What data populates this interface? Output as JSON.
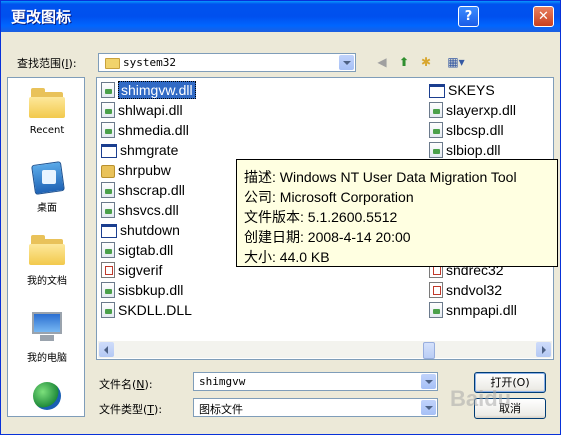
{
  "window": {
    "title": "更改图标",
    "help_label": "?",
    "close_label": "✕"
  },
  "lookin": {
    "label": "查找范围",
    "hotkey": "I",
    "label_suffix": "):",
    "value": "system32"
  },
  "toolbar": {
    "back_icon": "back-arrow-icon",
    "up_icon": "up-folder-icon",
    "new_folder_icon": "new-folder-icon",
    "views_icon": "views-menu-icon"
  },
  "places": [
    {
      "label": "Recent",
      "icon": "recent-folder-icon"
    },
    {
      "label": "桌面",
      "icon": "desktop-icon"
    },
    {
      "label": "我的文档",
      "icon": "my-documents-icon"
    },
    {
      "label": "我的电脑",
      "icon": "my-computer-icon"
    },
    {
      "label": "",
      "icon": "network-icon"
    }
  ],
  "files_col1": [
    {
      "name": "shimgvw.dll",
      "type": "dll",
      "selected": true
    },
    {
      "name": "shlwapi.dll",
      "type": "dll"
    },
    {
      "name": "shmedia.dll",
      "type": "dll"
    },
    {
      "name": "shmgrate",
      "type": "exe"
    },
    {
      "name": "shrpubw",
      "type": "folder"
    },
    {
      "name": "shscrap.dll",
      "type": "dll"
    },
    {
      "name": "shsvcs.dll",
      "type": "dll"
    },
    {
      "name": "shutdown",
      "type": "exe"
    },
    {
      "name": "sigtab.dll",
      "type": "dll"
    },
    {
      "name": "sigverif",
      "type": "generic"
    },
    {
      "name": "sisbkup.dll",
      "type": "dll"
    },
    {
      "name": "SKDLL.DLL",
      "type": "dll"
    }
  ],
  "files_col2": [
    {
      "name": "SKEYS",
      "type": "exe"
    },
    {
      "name": "slayerxp.dll",
      "type": "dll"
    },
    {
      "name": "slbcsp.dll",
      "type": "dll"
    },
    {
      "name": "slbiop.dll",
      "type": "dll"
    },
    {
      "name": "sndrec32",
      "type": "generic"
    },
    {
      "name": "sndvol32",
      "type": "generic"
    },
    {
      "name": "snmpapi.dll",
      "type": "dll"
    }
  ],
  "tooltip": {
    "desc": "描述: Windows NT User Data Migration Tool",
    "company": "公司: Microsoft Corporation",
    "version": "文件版本: 5.1.2600.5512",
    "created": "创建日期: 2008-4-14 20:00",
    "size": "大小: 44.0 KB"
  },
  "filename": {
    "label": "文件名",
    "hotkey": "N",
    "label_suffix": "):",
    "value": "shimgvw"
  },
  "filetype": {
    "label": "文件类型",
    "hotkey": "T",
    "label_suffix": "):",
    "value": "图标文件"
  },
  "buttons": {
    "open": "打开(O)",
    "cancel": "取消"
  },
  "watermark": "Baidu"
}
